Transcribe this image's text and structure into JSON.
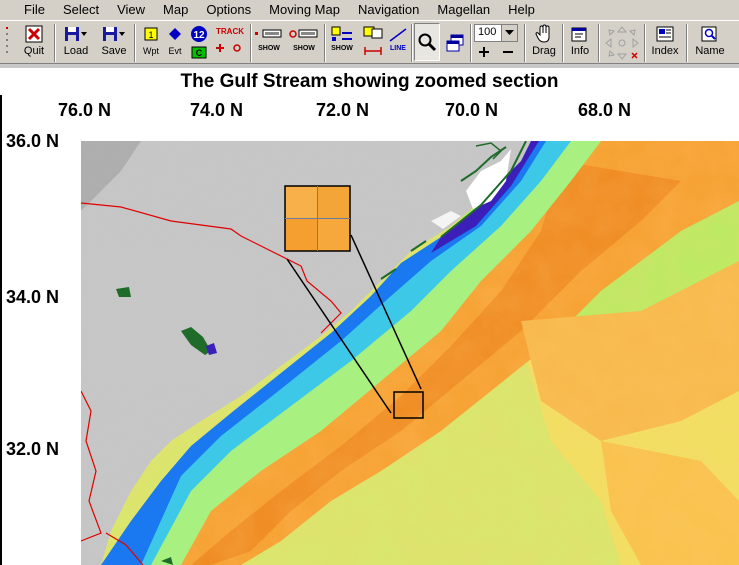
{
  "menu": [
    "File",
    "Select",
    "View",
    "Map",
    "Options",
    "Moving Map",
    "Navigation",
    "Magellan",
    "Help"
  ],
  "toolbar": {
    "quit": "Quit",
    "load": "Load",
    "save": "Save",
    "wpt": "Wpt",
    "evt": "Evt",
    "badge_1": "1",
    "badge_12": "12",
    "badge_c": "C",
    "track": "TRACK",
    "show": "SHOW",
    "line": "LINE",
    "zoom_value": "100",
    "drag": "Drag",
    "info": "Info",
    "index": "Index",
    "name": "Name"
  },
  "map": {
    "title": "The Gulf Stream showing zoomed section",
    "longitudes": [
      "76.0 N",
      "74.0 N",
      "72.0 N",
      "70.0 N",
      "68.0 N"
    ],
    "latitudes": [
      "36.0 N",
      "34.0 N",
      "32.0 N"
    ]
  }
}
